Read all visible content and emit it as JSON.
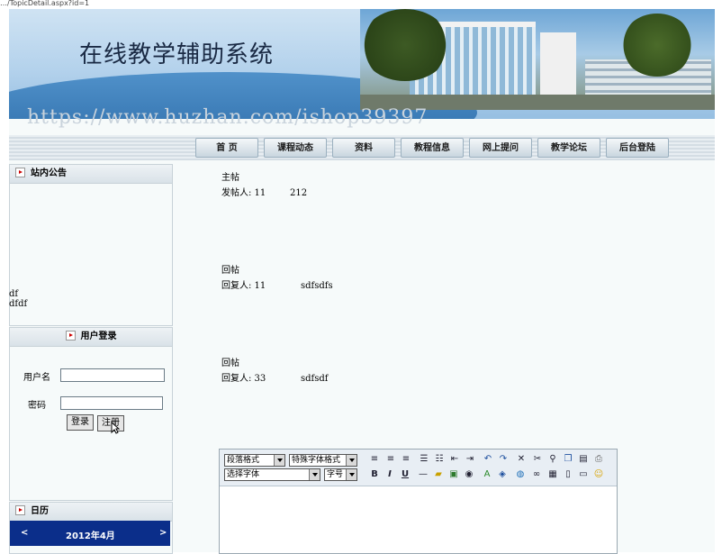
{
  "urlbar_text": "…/TopicDetail.aspx?id=1",
  "banner": {
    "title": "在线教学辅助系统"
  },
  "watermark": "https://www.huzhan.com/ishop39397",
  "nav": [
    "首  页",
    "课程动态",
    "资料",
    "教程信息",
    "网上提问",
    "教学论坛",
    "后台登陆"
  ],
  "notice": {
    "title": "站内公告",
    "lines": [
      "df",
      "dfdf"
    ]
  },
  "login": {
    "title": "用户登录",
    "username_label": "用户名",
    "password_label": "密码",
    "login_button": "登录",
    "register_button": "注册"
  },
  "calendar": {
    "title": "日历",
    "month": "2012年4月",
    "prev": "<",
    "next": ">"
  },
  "posts": [
    {
      "type": "主帖",
      "meta": "发帖人: 11",
      "content": "212"
    },
    {
      "type": "回帖",
      "meta": "回复人: 11",
      "content": "sdfsdfs"
    },
    {
      "type": "回帖",
      "meta": "回复人: 33",
      "content": "sdfsdf"
    }
  ],
  "editor": {
    "paragraph_format": "段落格式",
    "special_format": "特殊字体格式",
    "font_select": "选择字体",
    "font_size": "字号",
    "icons": [
      "align-left-icon",
      "align-center-icon",
      "align-right-icon",
      "bullet-list-icon",
      "numbered-list-icon",
      "outdent-icon",
      "indent-icon",
      "undo-icon",
      "redo-icon",
      "delete-icon",
      "cut-icon",
      "find-icon",
      "copy-icon",
      "paste-icon",
      "print-icon"
    ],
    "icons_row2": [
      "bold-icon",
      "italic-icon",
      "underline-icon",
      "hr-icon",
      "folder-icon",
      "image-icon",
      "media-icon",
      "flash-icon",
      "font-color-icon",
      "highlight-icon",
      "globe-icon",
      "link-icon",
      "table-icon",
      "form-icon",
      "date-icon",
      "emoticon-icon"
    ]
  }
}
